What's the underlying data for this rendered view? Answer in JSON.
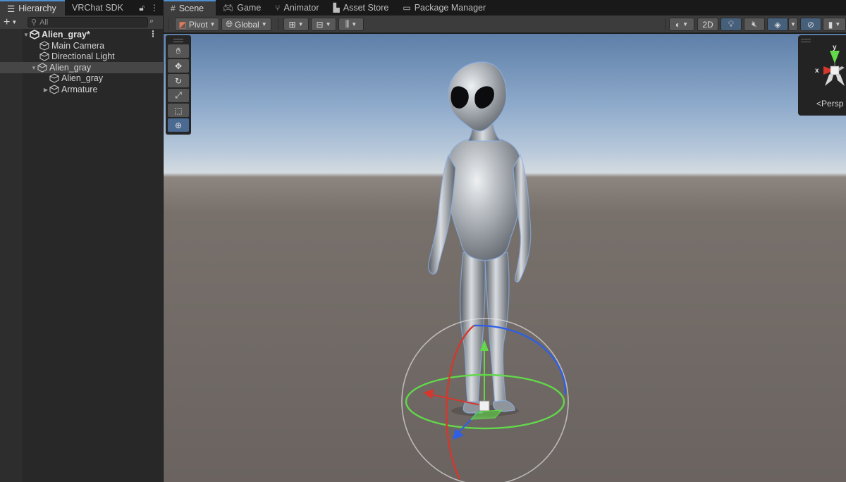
{
  "hierarchy": {
    "tabs": [
      {
        "label": "Hierarchy"
      },
      {
        "label": "VRChat SDK"
      }
    ],
    "search": {
      "placeholder": "All"
    },
    "tree": [
      {
        "label": "Alien_gray*",
        "depth": 0,
        "expanded": true,
        "scene": true
      },
      {
        "label": "Main Camera",
        "depth": 1
      },
      {
        "label": "Directional Light",
        "depth": 1
      },
      {
        "label": "Alien_gray",
        "depth": 1,
        "expanded": true,
        "selected": true
      },
      {
        "label": "Alien_gray",
        "depth": 2
      },
      {
        "label": "Armature",
        "depth": 2,
        "expanded": false
      }
    ]
  },
  "scene": {
    "tabs": [
      {
        "label": "Scene",
        "icon": "grid-icon"
      },
      {
        "label": "Game",
        "icon": "gamepad-icon"
      },
      {
        "label": "Animator",
        "icon": "animator-icon"
      },
      {
        "label": "Asset Store",
        "icon": "shopping-bag-icon"
      },
      {
        "label": "Package Manager",
        "icon": "package-icon"
      }
    ],
    "toolbar": {
      "pivot_label": "Pivot",
      "global_label": "Global",
      "mode_2d_label": "2D"
    },
    "tools": [
      "hand-tool",
      "move-tool",
      "rotate-tool",
      "scale-tool",
      "rect-tool",
      "transform-tool"
    ],
    "active_tool": "transform-tool",
    "gizmo": {
      "x_label": "x",
      "y_label": "y",
      "projection_label": "Persp"
    }
  },
  "colors": {
    "accent": "#4d8fd1",
    "x_axis": "#d6372c",
    "y_axis": "#62d84a",
    "z_axis": "#2f5fe6"
  }
}
